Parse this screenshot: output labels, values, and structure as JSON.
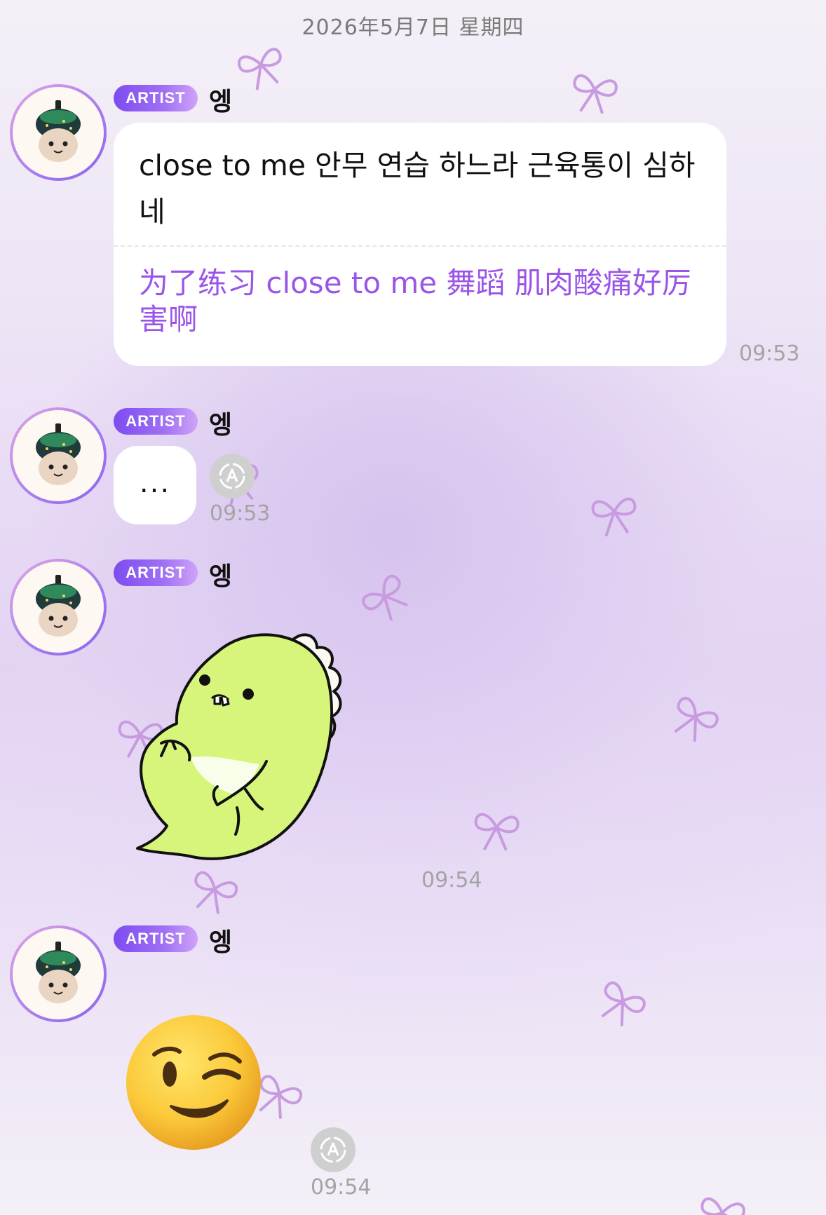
{
  "date_divider": "2026年5月7日 星期四",
  "colors": {
    "accent": "#9a55e8",
    "badge_start": "#7d4cf0",
    "badge_end": "#cfa3f8",
    "bubble": "#ffffff",
    "timestamp": "#a4a4a4",
    "background": "#e3d3f3"
  },
  "messages": [
    {
      "badge": "ARTIST",
      "sender": "엥",
      "text": "close to me 안무 연습 하느라 근육통이 심하네",
      "translation": "为了练习 close to me 舞蹈 肌肉酸痛好厉害啊",
      "time": "09:53"
    },
    {
      "badge": "ARTIST",
      "sender": "엥",
      "text": "...",
      "time": "09:53",
      "icon": "auto-translate-icon"
    },
    {
      "badge": "ARTIST",
      "sender": "엥",
      "sticker": "green-dinosaur-sticker",
      "time": "09:54"
    },
    {
      "badge": "ARTIST",
      "sender": "엥",
      "sticker": "winking-face-emoji",
      "time": "09:54",
      "icon": "auto-translate-icon"
    }
  ]
}
